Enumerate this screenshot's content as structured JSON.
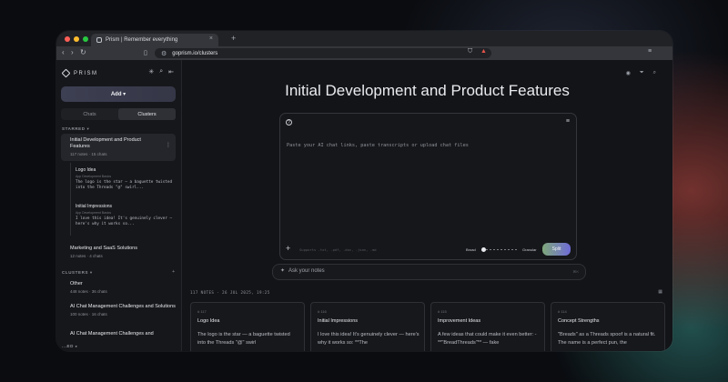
{
  "browser": {
    "tab_title": "Prism | Remember everything",
    "new_tab": "+",
    "url": "goprism.io/clusters"
  },
  "sidebar": {
    "brand": "PRISM",
    "add_button": "Add ▾",
    "toggle": {
      "chats": "Chats",
      "clusters": "Clusters"
    },
    "starred_label": "STARRED ▾",
    "clusters_label": "CLUSTERS ▾",
    "section_plus": "+",
    "bottom_label": "...ED ▸",
    "starred_clusters": [
      {
        "title": "Initial Development and Product Features",
        "meta": "117 notes · 15 chats"
      },
      {
        "title": "Marketing and SaaS Solutions",
        "meta": "12 notes · 4 chats"
      }
    ],
    "sub_notes": [
      {
        "title": "Logo Idea",
        "source": "App Development Basics",
        "snippet": "The logo is the star — a baguette twisted into the Threads \"@\" swirl..."
      },
      {
        "title": "Initial Impressions",
        "source": "App Development Basics",
        "snippet": "I love this idea! It's genuinely clever — here's why it works so..."
      }
    ],
    "clusters": [
      {
        "title": "Other",
        "meta": "448 notes · 36 chats"
      },
      {
        "title": "AI Chat Management Challenges and Solutions",
        "meta": "100 notes · 16 chats"
      },
      {
        "title": "AI Chat Management Challenges and",
        "meta": ""
      }
    ]
  },
  "main": {
    "title": "Initial Development and Product Features",
    "composer": {
      "placeholder": "Paste your AI chat links, paste transcripts or upload chat files",
      "formats": "Supports .txt, .pdf, .doc, .json, .md",
      "broad": "Broad",
      "granular": "Granular",
      "split": "Split"
    },
    "ask": {
      "placeholder": "Ask your notes",
      "shortcut": "⌘K"
    },
    "notes_meta": "117 NOTES  ·  26 JUL 2025, 19:25",
    "notes": [
      {
        "id": "# 117",
        "title": "Logo Idea",
        "body": "The logo is the star — a baguette twisted into the Threads \"@\" swirl"
      },
      {
        "id": "# 116",
        "title": "Initial Impressions",
        "body": "I love this idea! It's genuinely clever — here's why it works so: **The"
      },
      {
        "id": "# 115",
        "title": "Improvement Ideas",
        "body": "A few ideas that could make it even better: - **\"BreadThreads\"** — fake"
      },
      {
        "id": "# 114",
        "title": "Concept Strengths",
        "body": "\"Breads\" as a Threads spoof is a natural fit. The name is a perfect pun, the"
      }
    ]
  }
}
